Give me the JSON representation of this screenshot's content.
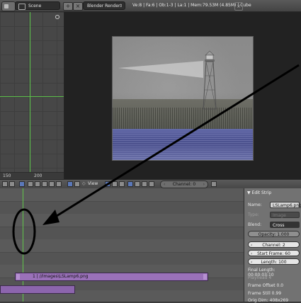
{
  "header": {
    "scene_name": "Scene",
    "render_engine": "Blender Render",
    "stats": "Ve:8 | Fa:6 | Ob:1-3 | La:1 | Mem:79.53M (4.85M) | Cube"
  },
  "graph": {
    "scale_left": "150",
    "scale_right": "200"
  },
  "sequencer": {
    "view_menu": "View",
    "channel": "Channel: 0",
    "strip_label": "1 | //Images\\LSLamp6.png"
  },
  "properties": {
    "title": "▼ Edit Strip",
    "name_label": "Name:",
    "name_value": "LSLamp6.png",
    "type_label": "Type:",
    "type_value": "Image",
    "blend_label": "Blend:",
    "blend_value": "Cross",
    "opacity": "Opacity: 1.000",
    "channel": "Channel: 2",
    "start_frame": "Start Frame: 60",
    "length": "Length: 100",
    "final_length": "Final Length: 00:00:03:10",
    "playhead": "Playhead 4",
    "frame_offset": "Frame Offset 0.0",
    "frame_still": "Frame Still 0.99",
    "orig_dim": "Orig Dim: 408x269"
  },
  "colors": {
    "playhead_green": "#62c84b",
    "strip_purple": "#9a71b9",
    "annotation": "#000000"
  }
}
